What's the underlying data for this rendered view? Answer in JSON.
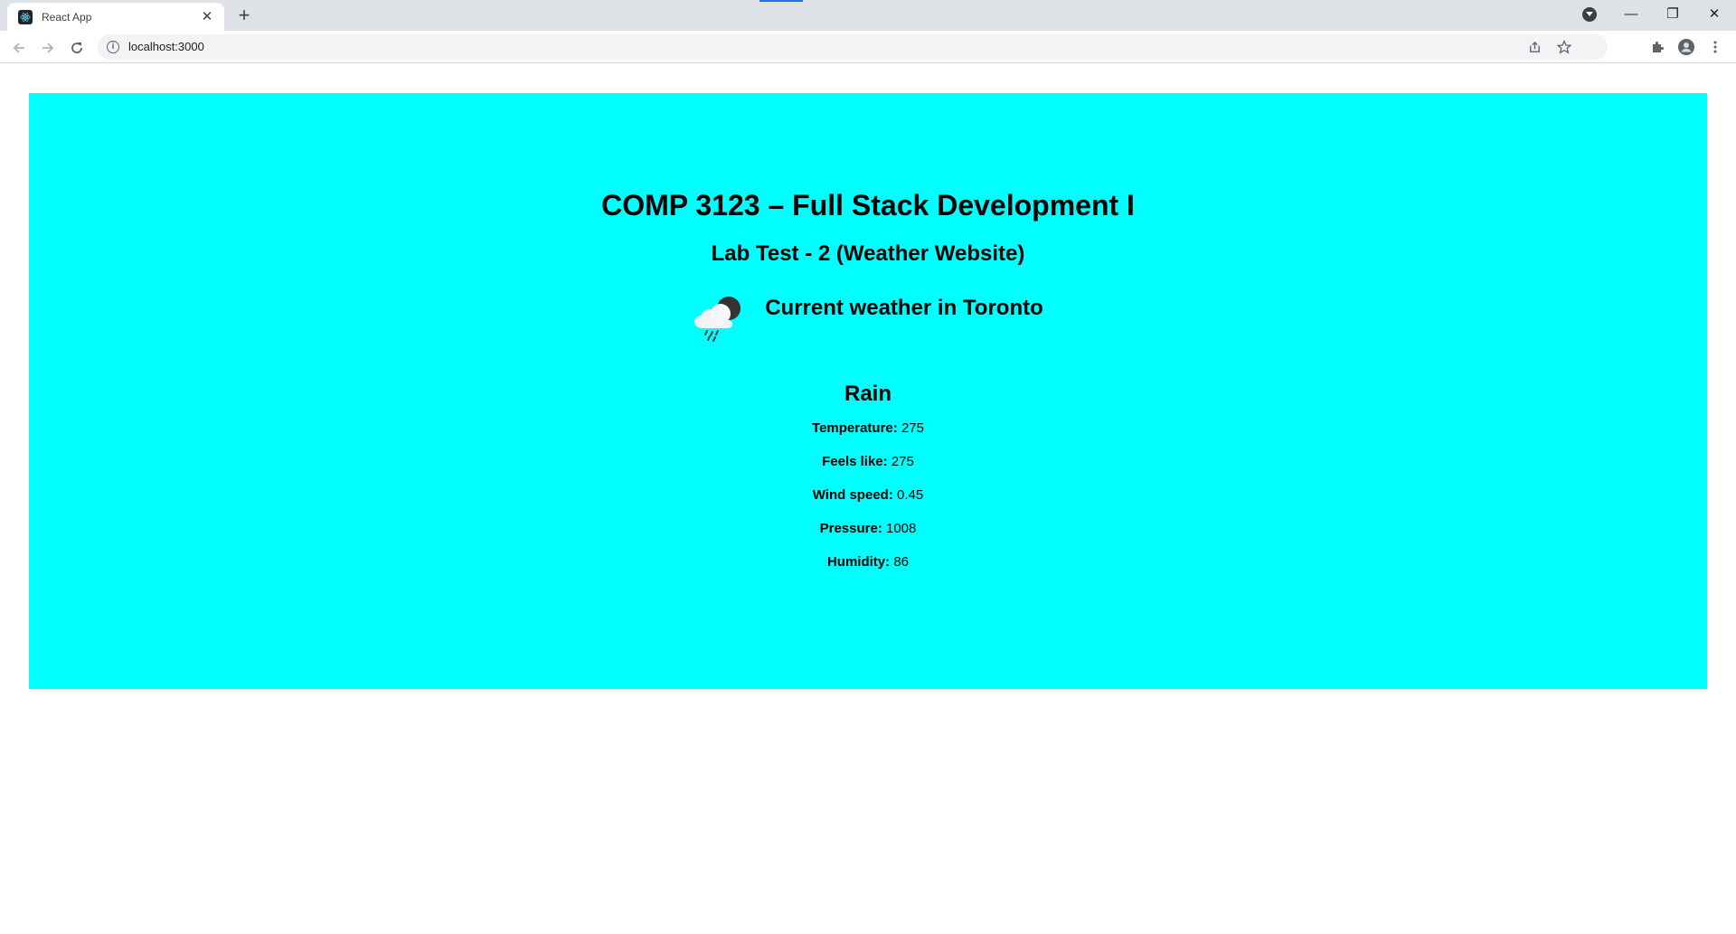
{
  "browser": {
    "tab_title": "React App",
    "tab_close": "✕",
    "new_tab": "+",
    "url": "localhost:3000",
    "info_glyph": "i",
    "window_controls": {
      "minimize": "—",
      "restore": "❐",
      "close": "✕"
    }
  },
  "page": {
    "title": "COMP 3123 – Full Stack Development I",
    "subtitle": "Lab Test - 2 (Weather Website)",
    "current_heading": "Current weather in Toronto",
    "weather_icon": "rain-cloud-moon-icon",
    "condition": "Rain",
    "stats": [
      {
        "label": "Temperature:",
        "value": "275"
      },
      {
        "label": "Feels like:",
        "value": "275"
      },
      {
        "label": "Wind speed:",
        "value": "0.45"
      },
      {
        "label": "Pressure:",
        "value": "1008"
      },
      {
        "label": "Humidity:",
        "value": "86"
      }
    ]
  },
  "colors": {
    "panel_background": "#00ffff",
    "tabstrip_background": "#dee1e6"
  }
}
